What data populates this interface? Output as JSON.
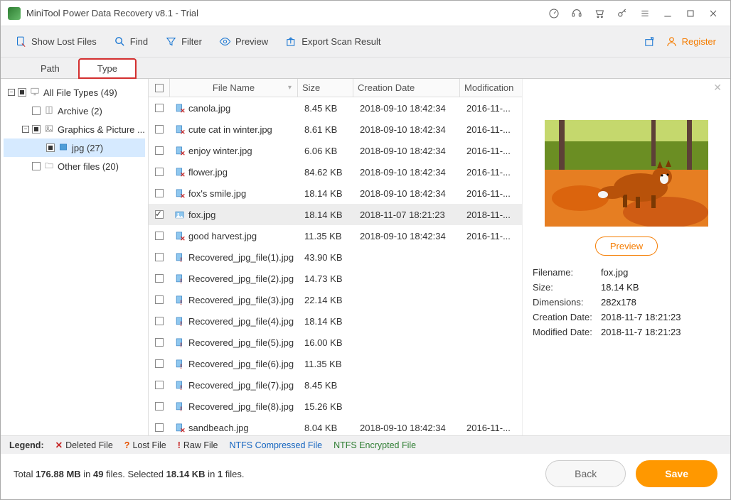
{
  "title": "MiniTool Power Data Recovery v8.1 - Trial",
  "toolbar": {
    "show_lost": "Show Lost Files",
    "find": "Find",
    "filter": "Filter",
    "preview": "Preview",
    "export": "Export Scan Result",
    "register": "Register"
  },
  "tabs": {
    "path": "Path",
    "type": "Type"
  },
  "tree": [
    {
      "indent": 0,
      "sq": "−",
      "cb": "part",
      "icon": "pc",
      "label": "All File Types (49)"
    },
    {
      "indent": 1,
      "sq": "",
      "cb": "",
      "icon": "archive",
      "label": "Archive (2)"
    },
    {
      "indent": 1,
      "sq": "−",
      "cb": "part",
      "icon": "pic",
      "label": "Graphics & Picture ..."
    },
    {
      "indent": 2,
      "sq": "",
      "cb": "part",
      "icon": "jpg",
      "label": "jpg (27)",
      "sel": true
    },
    {
      "indent": 1,
      "sq": "",
      "cb": "",
      "icon": "folder",
      "label": "Other files (20)"
    }
  ],
  "cols": {
    "name": "File Name",
    "size": "Size",
    "cre": "Creation Date",
    "mod": "Modification"
  },
  "files": [
    {
      "name": "canola.jpg",
      "size": "8.45 KB",
      "cre": "2018-09-10 18:42:34",
      "mod": "2016-11-...",
      "t": "del"
    },
    {
      "name": "cute cat in winter.jpg",
      "size": "8.61 KB",
      "cre": "2018-09-10 18:42:34",
      "mod": "2016-11-...",
      "t": "del"
    },
    {
      "name": "enjoy winter.jpg",
      "size": "6.06 KB",
      "cre": "2018-09-10 18:42:34",
      "mod": "2016-11-...",
      "t": "del"
    },
    {
      "name": "flower.jpg",
      "size": "84.62 KB",
      "cre": "2018-09-10 18:42:34",
      "mod": "2016-11-...",
      "t": "del"
    },
    {
      "name": "fox's smile.jpg",
      "size": "18.14 KB",
      "cre": "2018-09-10 18:42:34",
      "mod": "2016-11-...",
      "t": "del"
    },
    {
      "name": "fox.jpg",
      "size": "18.14 KB",
      "cre": "2018-11-07 18:21:23",
      "mod": "2018-11-...",
      "t": "img",
      "chk": true,
      "sel": true
    },
    {
      "name": "good harvest.jpg",
      "size": "11.35 KB",
      "cre": "2018-09-10 18:42:34",
      "mod": "2016-11-...",
      "t": "del"
    },
    {
      "name": "Recovered_jpg_file(1).jpg",
      "size": "43.90 KB",
      "cre": "",
      "mod": "",
      "t": "raw"
    },
    {
      "name": "Recovered_jpg_file(2).jpg",
      "size": "14.73 KB",
      "cre": "",
      "mod": "",
      "t": "raw"
    },
    {
      "name": "Recovered_jpg_file(3).jpg",
      "size": "22.14 KB",
      "cre": "",
      "mod": "",
      "t": "raw"
    },
    {
      "name": "Recovered_jpg_file(4).jpg",
      "size": "18.14 KB",
      "cre": "",
      "mod": "",
      "t": "raw"
    },
    {
      "name": "Recovered_jpg_file(5).jpg",
      "size": "16.00 KB",
      "cre": "",
      "mod": "",
      "t": "raw"
    },
    {
      "name": "Recovered_jpg_file(6).jpg",
      "size": "11.35 KB",
      "cre": "",
      "mod": "",
      "t": "raw"
    },
    {
      "name": "Recovered_jpg_file(7).jpg",
      "size": "8.45 KB",
      "cre": "",
      "mod": "",
      "t": "raw"
    },
    {
      "name": "Recovered_jpg_file(8).jpg",
      "size": "15.26 KB",
      "cre": "",
      "mod": "",
      "t": "raw"
    },
    {
      "name": "sandbeach.jpg",
      "size": "8.04 KB",
      "cre": "2018-09-10 18:42:34",
      "mod": "2016-11-...",
      "t": "del"
    }
  ],
  "preview": {
    "btn": "Preview",
    "meta": [
      {
        "k": "Filename:",
        "v": "fox.jpg"
      },
      {
        "k": "Size:",
        "v": "18.14 KB"
      },
      {
        "k": "Dimensions:",
        "v": "282x178"
      },
      {
        "k": "Creation Date:",
        "v": "2018-11-7 18:21:23"
      },
      {
        "k": "Modified Date:",
        "v": "2018-11-7 18:21:23"
      }
    ]
  },
  "legend": {
    "label": "Legend:",
    "deleted": "Deleted File",
    "lost": "Lost File",
    "raw": "Raw File",
    "ntfs_c": "NTFS Compressed File",
    "ntfs_e": "NTFS Encrypted File"
  },
  "status": {
    "p1": "Total ",
    "p2": "176.88 MB",
    "p3": " in ",
    "p4": "49",
    "p5": " files.   Selected ",
    "p6": "18.14 KB",
    "p7": " in ",
    "p8": "1",
    "p9": " files."
  },
  "buttons": {
    "back": "Back",
    "save": "Save"
  }
}
